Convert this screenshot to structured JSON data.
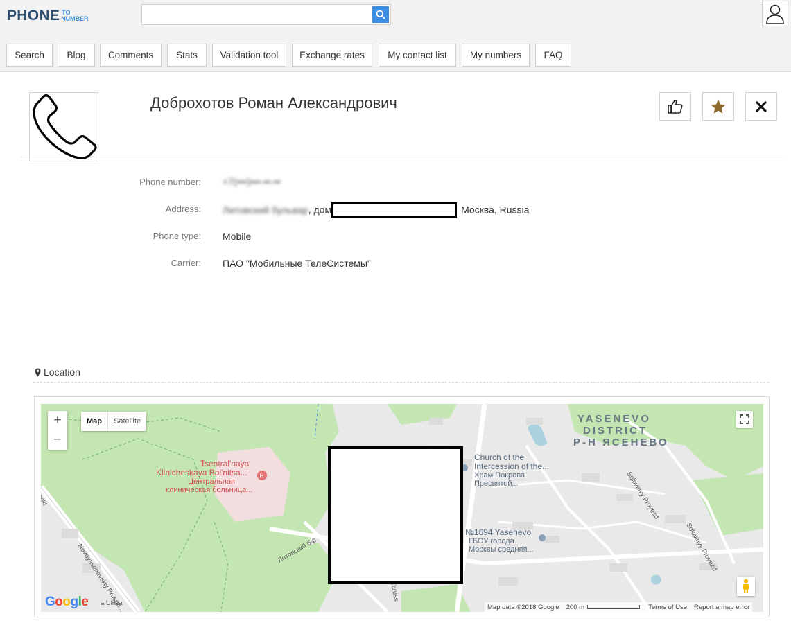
{
  "header": {
    "logo_main": "PHONE",
    "logo_to": "TO",
    "logo_number": "NUMBER",
    "search_placeholder": "",
    "search_value": "",
    "search_icon": "search-icon",
    "user_icon": "user-icon"
  },
  "nav": {
    "items": [
      {
        "label": "Search"
      },
      {
        "label": "Blog"
      },
      {
        "label": "Comments"
      },
      {
        "label": "Stats"
      },
      {
        "label": "Validation tool"
      },
      {
        "label": "Exchange rates"
      },
      {
        "label": "My contact list"
      },
      {
        "label": "My numbers"
      },
      {
        "label": "FAQ"
      }
    ]
  },
  "profile": {
    "name": "Доброхотов Роман Александрович",
    "avatar_icon": "phone-handset-icon",
    "actions": {
      "like_icon": "thumbs-up-icon",
      "favorite_icon": "star-icon",
      "remove_icon": "close-icon"
    },
    "fields": {
      "phone_label": "Phone number:",
      "phone_value": "+7(•••)•••-••-••",
      "address_label": "Address:",
      "address_blurred": "Литовский бульвар",
      "address_visible": ", дом",
      "address_tail": "Москва, Russia",
      "type_label": "Phone type:",
      "type_value": "Mobile",
      "carrier_label": "Carrier:",
      "carrier_value": "ПАО \"Мобильные ТелеСистемы\""
    }
  },
  "location": {
    "title": "Location",
    "title_icon": "map-marker-icon",
    "map": {
      "zoom_in": "+",
      "zoom_out": "−",
      "type_map": "Map",
      "type_satellite": "Satellite",
      "fullscreen_icon": "fullscreen-icon",
      "pegman_icon": "pegman-icon",
      "google_logo": "Google",
      "attribution": "Map data ©2018 Google",
      "scale": "200 m",
      "terms": "Terms of Use",
      "report": "Report a map error",
      "labels": {
        "district_en_1": "YASENEVO",
        "district_en_2": "DISTRICT",
        "district_ru": "Р-Н ЯСЕНЕВО",
        "hospital_en_1": "Tsentral'naya",
        "hospital_en_2": "Klinicheskaya Bol'nitsa...",
        "hospital_ru_1": "Центральная",
        "hospital_ru_2": "клиническая больница...",
        "church_en_1": "Church of the",
        "church_en_2": "Intercession of the...",
        "church_ru_1": "Храм Покрова",
        "church_ru_2": "Пресвятой...",
        "school_1": "№1694 Yasenevo",
        "school_2": "ГБОУ города",
        "school_3": "Москвы средняя...",
        "street_novoyasenevsky": "Novoyasenevskiy Prospe...",
        "street_solovinyy": "Solovinyy Proyezd",
        "street_solovinyy2": "Solovinyy Proyezd",
        "street_litovsky": "Литовский б-р",
        "street_taruss": "Taruss",
        "street_pekt": "pekt",
        "street_ulitsa": "a Ulitsa"
      }
    }
  },
  "colors": {
    "accent": "#3c8ee6",
    "logo_dark": "#2f4f6f",
    "logo_light": "#3a8fd8",
    "star": "#8b6a2c",
    "park": "#c4e6b2",
    "hospital": "#f2dede",
    "hospital_text": "#d9534f"
  }
}
